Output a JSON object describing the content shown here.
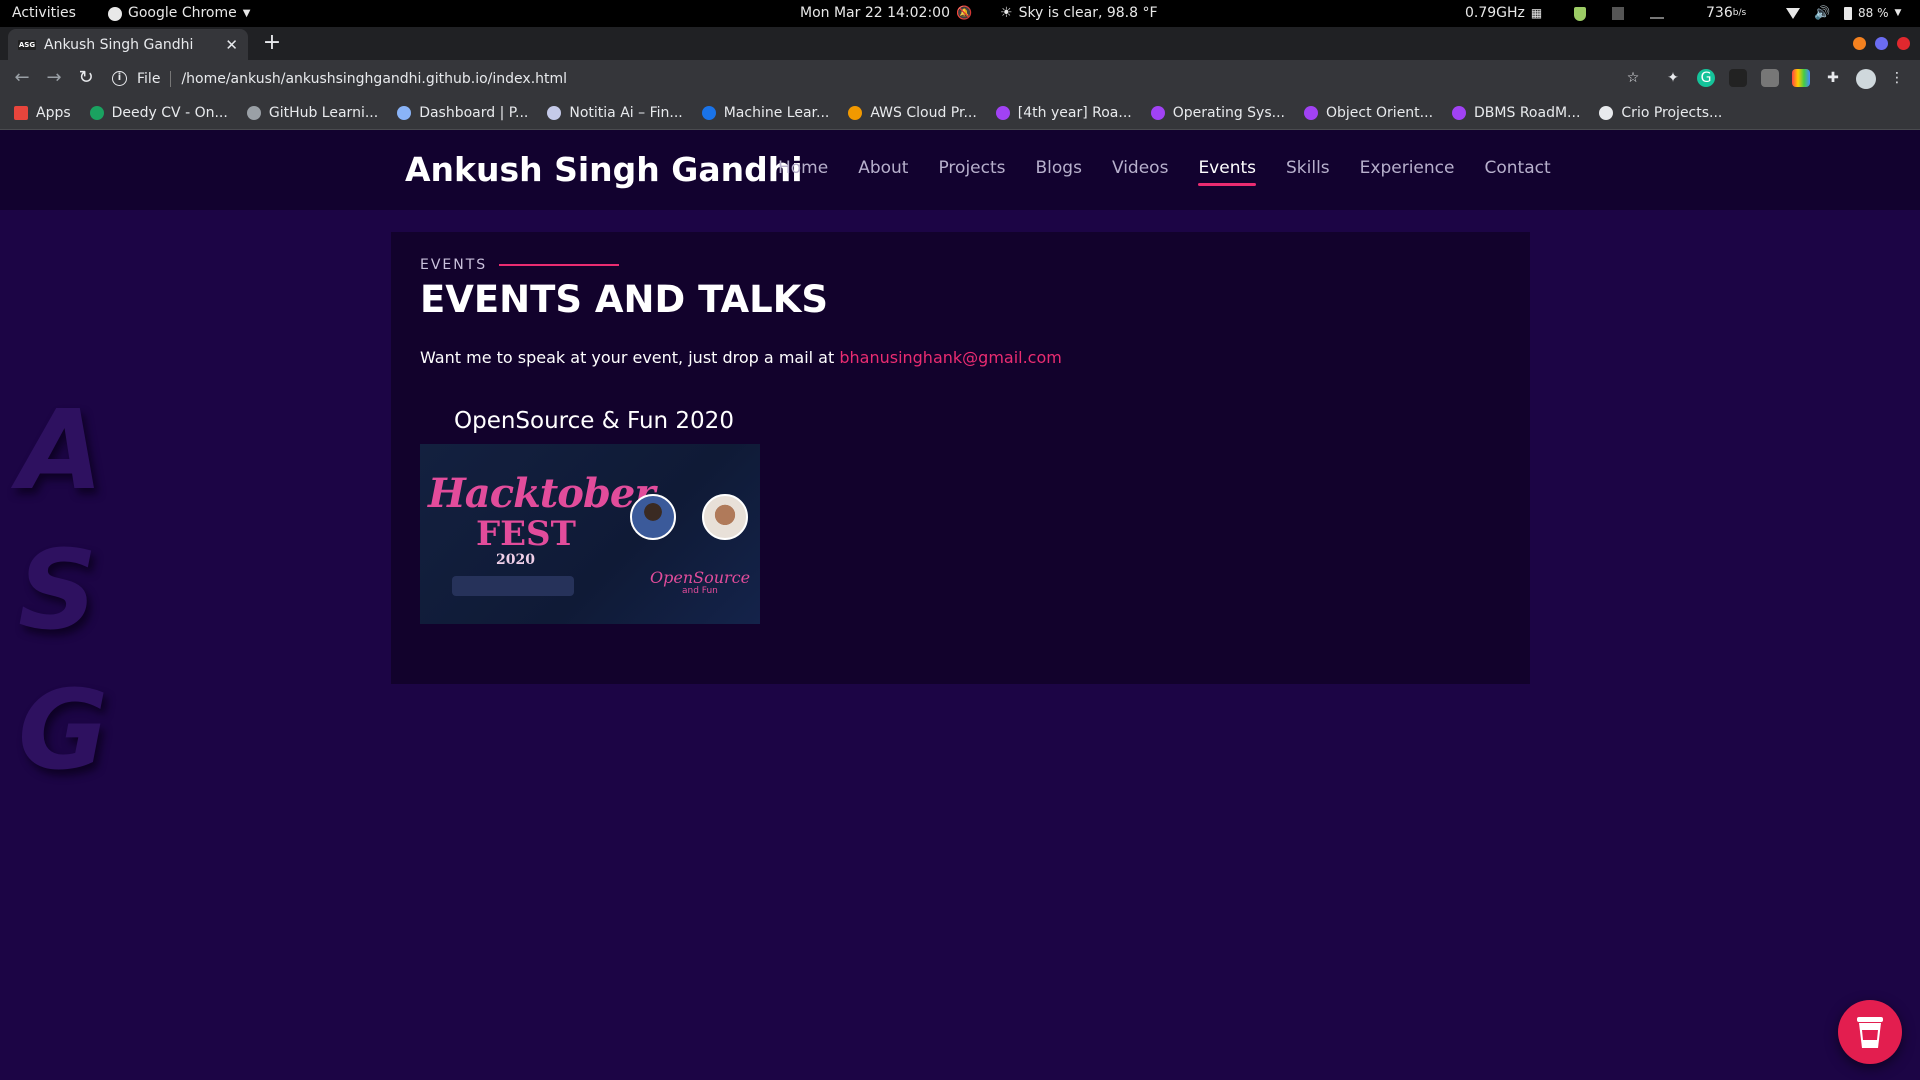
{
  "topbar": {
    "activities": "Activities",
    "app_name": "Google Chrome",
    "datetime": "Mon Mar 22  14:02:00",
    "weather": "Sky is clear, 98.8 °F",
    "cpu": "0.79GHz",
    "netspeed": "736",
    "netspeed_unit": "b/s",
    "battery": "88 %"
  },
  "browser": {
    "tab_title": "Ankush Singh Gandhi",
    "tab_favicon_text": "ASG",
    "url_scheme_label": "File",
    "url": "/home/ankush/ankushsinghgandhi.github.io/index.html"
  },
  "bookmarks": [
    {
      "label": "Apps",
      "icon_color": "#e8453c"
    },
    {
      "label": "Deedy CV - On...",
      "icon_color": "#1aa260"
    },
    {
      "label": "GitHub Learni...",
      "icon_color": "#9aa0a6"
    },
    {
      "label": "Dashboard | P...",
      "icon_color": "#8ab4f8"
    },
    {
      "label": "Notitia Ai – Fin...",
      "icon_color": "#c5cae9"
    },
    {
      "label": "Machine Lear...",
      "icon_color": "#1a73e8"
    },
    {
      "label": "AWS Cloud Pr...",
      "icon_color": "#f29900"
    },
    {
      "label": "[4th year] Roa...",
      "icon_color": "#a142f4"
    },
    {
      "label": "Operating Sys...",
      "icon_color": "#a142f4"
    },
    {
      "label": "Object Orient...",
      "icon_color": "#a142f4"
    },
    {
      "label": "DBMS RoadM...",
      "icon_color": "#a142f4"
    },
    {
      "label": "Crio Projects...",
      "icon_color": "#e8eaed"
    }
  ],
  "site": {
    "brand": "Ankush Singh Gandhi",
    "nav": [
      "Home",
      "About",
      "Projects",
      "Blogs",
      "Videos",
      "Events",
      "Skills",
      "Experience",
      "Contact"
    ],
    "nav_active": "Events",
    "side_letters": [
      "A",
      "S",
      "G"
    ],
    "section_label": "EVENTS",
    "section_title": "EVENTS AND TALKS",
    "section_desc": "Want me to speak at your event, just drop a mail at ",
    "email": "bhanusinghank@gmail.com",
    "event": {
      "title": "OpenSource & Fun 2020",
      "image_text_1": "Hacktober",
      "image_text_2": "FEST",
      "image_text_3": "2020",
      "image_text_4": "OpenSource",
      "image_text_5": "and Fun"
    }
  },
  "colors": {
    "accent": "#ea2c71",
    "page_bg": "#1c0545",
    "header_bg": "#12022f",
    "card_bg": "#12022c"
  }
}
